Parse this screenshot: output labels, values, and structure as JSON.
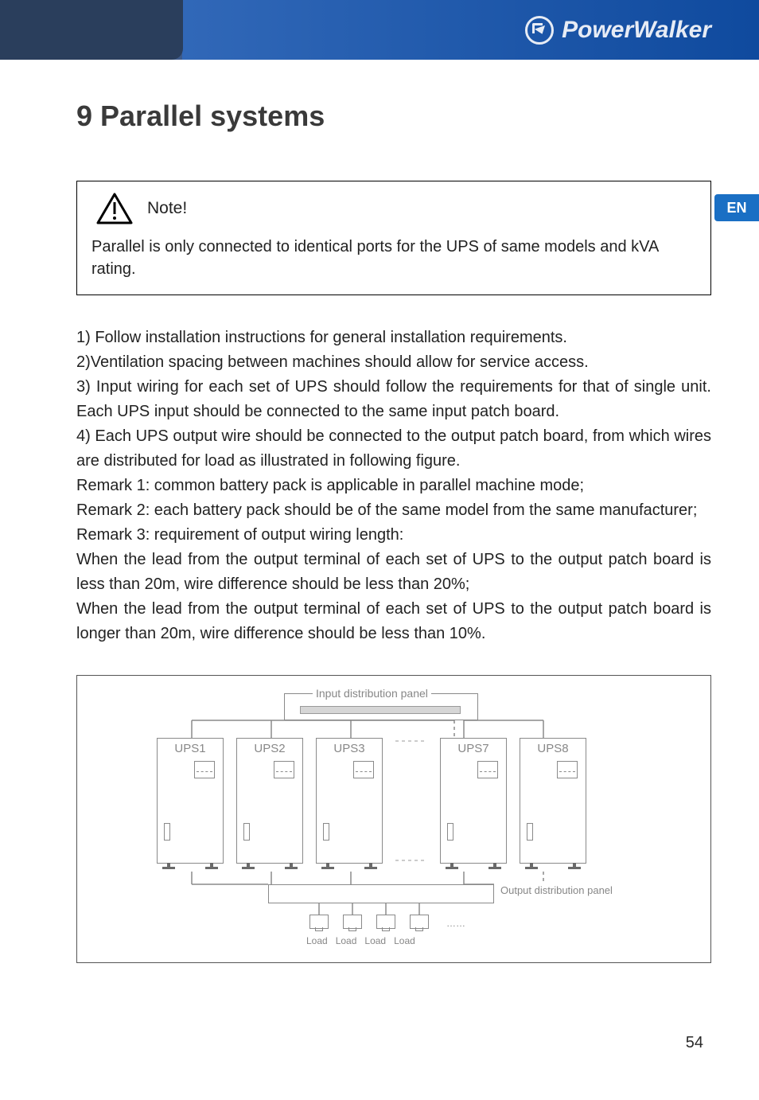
{
  "header": {
    "brand": "PowerWalker"
  },
  "lang_badge": "EN",
  "title": "9 Parallel systems",
  "note": {
    "label": "Note!",
    "text": "Parallel is only connected to identical ports for the UPS of same models and kVA rating."
  },
  "body": {
    "p1": "1) Follow installation instructions for general installation requirements.",
    "p2": "2)Ventilation spacing between machines should allow for service access.",
    "p3": "3) Input wiring for each set of UPS should follow the requirements for that of single unit. Each UPS input should be connected to the same input patch board.",
    "p4": "4) Each UPS output wire should be connected to the output patch board, from which wires are distributed for load as illustrated in following figure.",
    "r1": "Remark 1: common battery pack is applicable in parallel machine mode;",
    "r2": "Remark 2: each battery pack should be of the same model from the same manufacturer;",
    "r3": "Remark 3: requirement of output wiring length:",
    "w1": "When the lead from the output terminal of each set of UPS to the output patch board is less than 20m, wire difference should be less than 20%;",
    "w2": "When the lead from the output terminal of each set of UPS to the output patch board is longer than 20m, wire difference should be less than 10%."
  },
  "figure": {
    "input_panel": "Input distribution panel",
    "output_panel": "Output distribution panel",
    "ups": [
      "UPS1",
      "UPS2",
      "UPS3",
      "UPS7",
      "UPS8"
    ],
    "load_label": "Load",
    "ellipsis": "……"
  },
  "page_number": "54"
}
